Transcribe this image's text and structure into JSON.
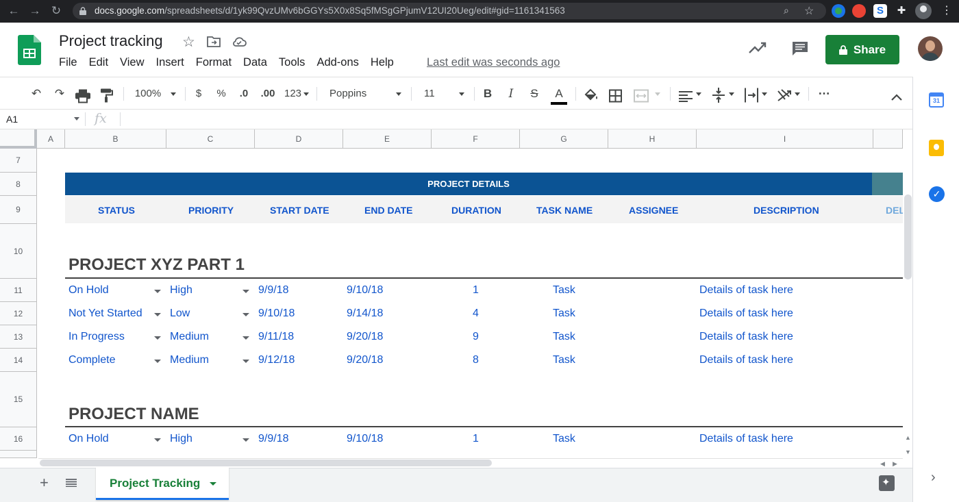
{
  "browser": {
    "url_host": "docs.google.com",
    "url_path": "/spreadsheets/d/1yk99QvzUMv6bGGYs5X0x8Sq5fMSgGPjumV12UI20Ueg/edit#gid=1161341563"
  },
  "doc": {
    "title": "Project tracking",
    "menu": [
      "File",
      "Edit",
      "View",
      "Insert",
      "Format",
      "Data",
      "Tools",
      "Add-ons",
      "Help"
    ],
    "last_edit": "Last edit was seconds ago",
    "share_label": "Share"
  },
  "toolbar": {
    "zoom": "100%",
    "currency": "$",
    "percent": "%",
    "dec_decrease": ".0",
    "dec_increase": ".00",
    "more_formats": "123",
    "font": "Poppins",
    "font_size": "11",
    "bold": "B",
    "italic": "I",
    "strike": "S",
    "text_color": "A",
    "more": "⋯"
  },
  "formula_bar": {
    "cell_ref": "A1",
    "fx": "fx",
    "value": ""
  },
  "grid": {
    "columns": [
      "A",
      "B",
      "C",
      "D",
      "E",
      "F",
      "G",
      "H",
      "I"
    ],
    "rows": [
      "7",
      "8",
      "9",
      "10",
      "11",
      "12",
      "13",
      "14",
      "15",
      "16"
    ],
    "banner": "PROJECT DETAILS",
    "headers": [
      "STATUS",
      "PRIORITY",
      "START DATE",
      "END DATE",
      "DURATION",
      "TASK NAME",
      "ASSIGNEE",
      "DESCRIPTION",
      "DEL"
    ],
    "sections": [
      {
        "title": "PROJECT XYZ PART 1",
        "rows": [
          {
            "status": "On Hold",
            "priority": "High",
            "start": "9/9/18",
            "end": "9/10/18",
            "duration": "1",
            "task": "Task",
            "description": "Details of task here"
          },
          {
            "status": "Not Yet Started",
            "priority": "Low",
            "start": "9/10/18",
            "end": "9/14/18",
            "duration": "4",
            "task": "Task",
            "description": "Details of task here"
          },
          {
            "status": "In Progress",
            "priority": "Medium",
            "start": "9/11/18",
            "end": "9/20/18",
            "duration": "9",
            "task": "Task",
            "description": "Details of task here"
          },
          {
            "status": "Complete",
            "priority": "Medium",
            "start": "9/12/18",
            "end": "9/20/18",
            "duration": "8",
            "task": "Task",
            "description": "Details of task here"
          }
        ]
      },
      {
        "title": "PROJECT NAME",
        "rows": [
          {
            "status": "On Hold",
            "priority": "High",
            "start": "9/9/18",
            "end": "9/10/18",
            "duration": "1",
            "task": "Task",
            "description": "Details of task here"
          }
        ]
      }
    ]
  },
  "tabs": {
    "active": "Project Tracking"
  },
  "side_panel": {
    "calendar_day": "31",
    "icons": [
      "calendar-icon",
      "keep-icon",
      "tasks-icon"
    ]
  },
  "colors": {
    "banner": "#0b5394",
    "accent_teal": "#45818e",
    "cell_text": "#1155cc",
    "share_green": "#188038"
  }
}
